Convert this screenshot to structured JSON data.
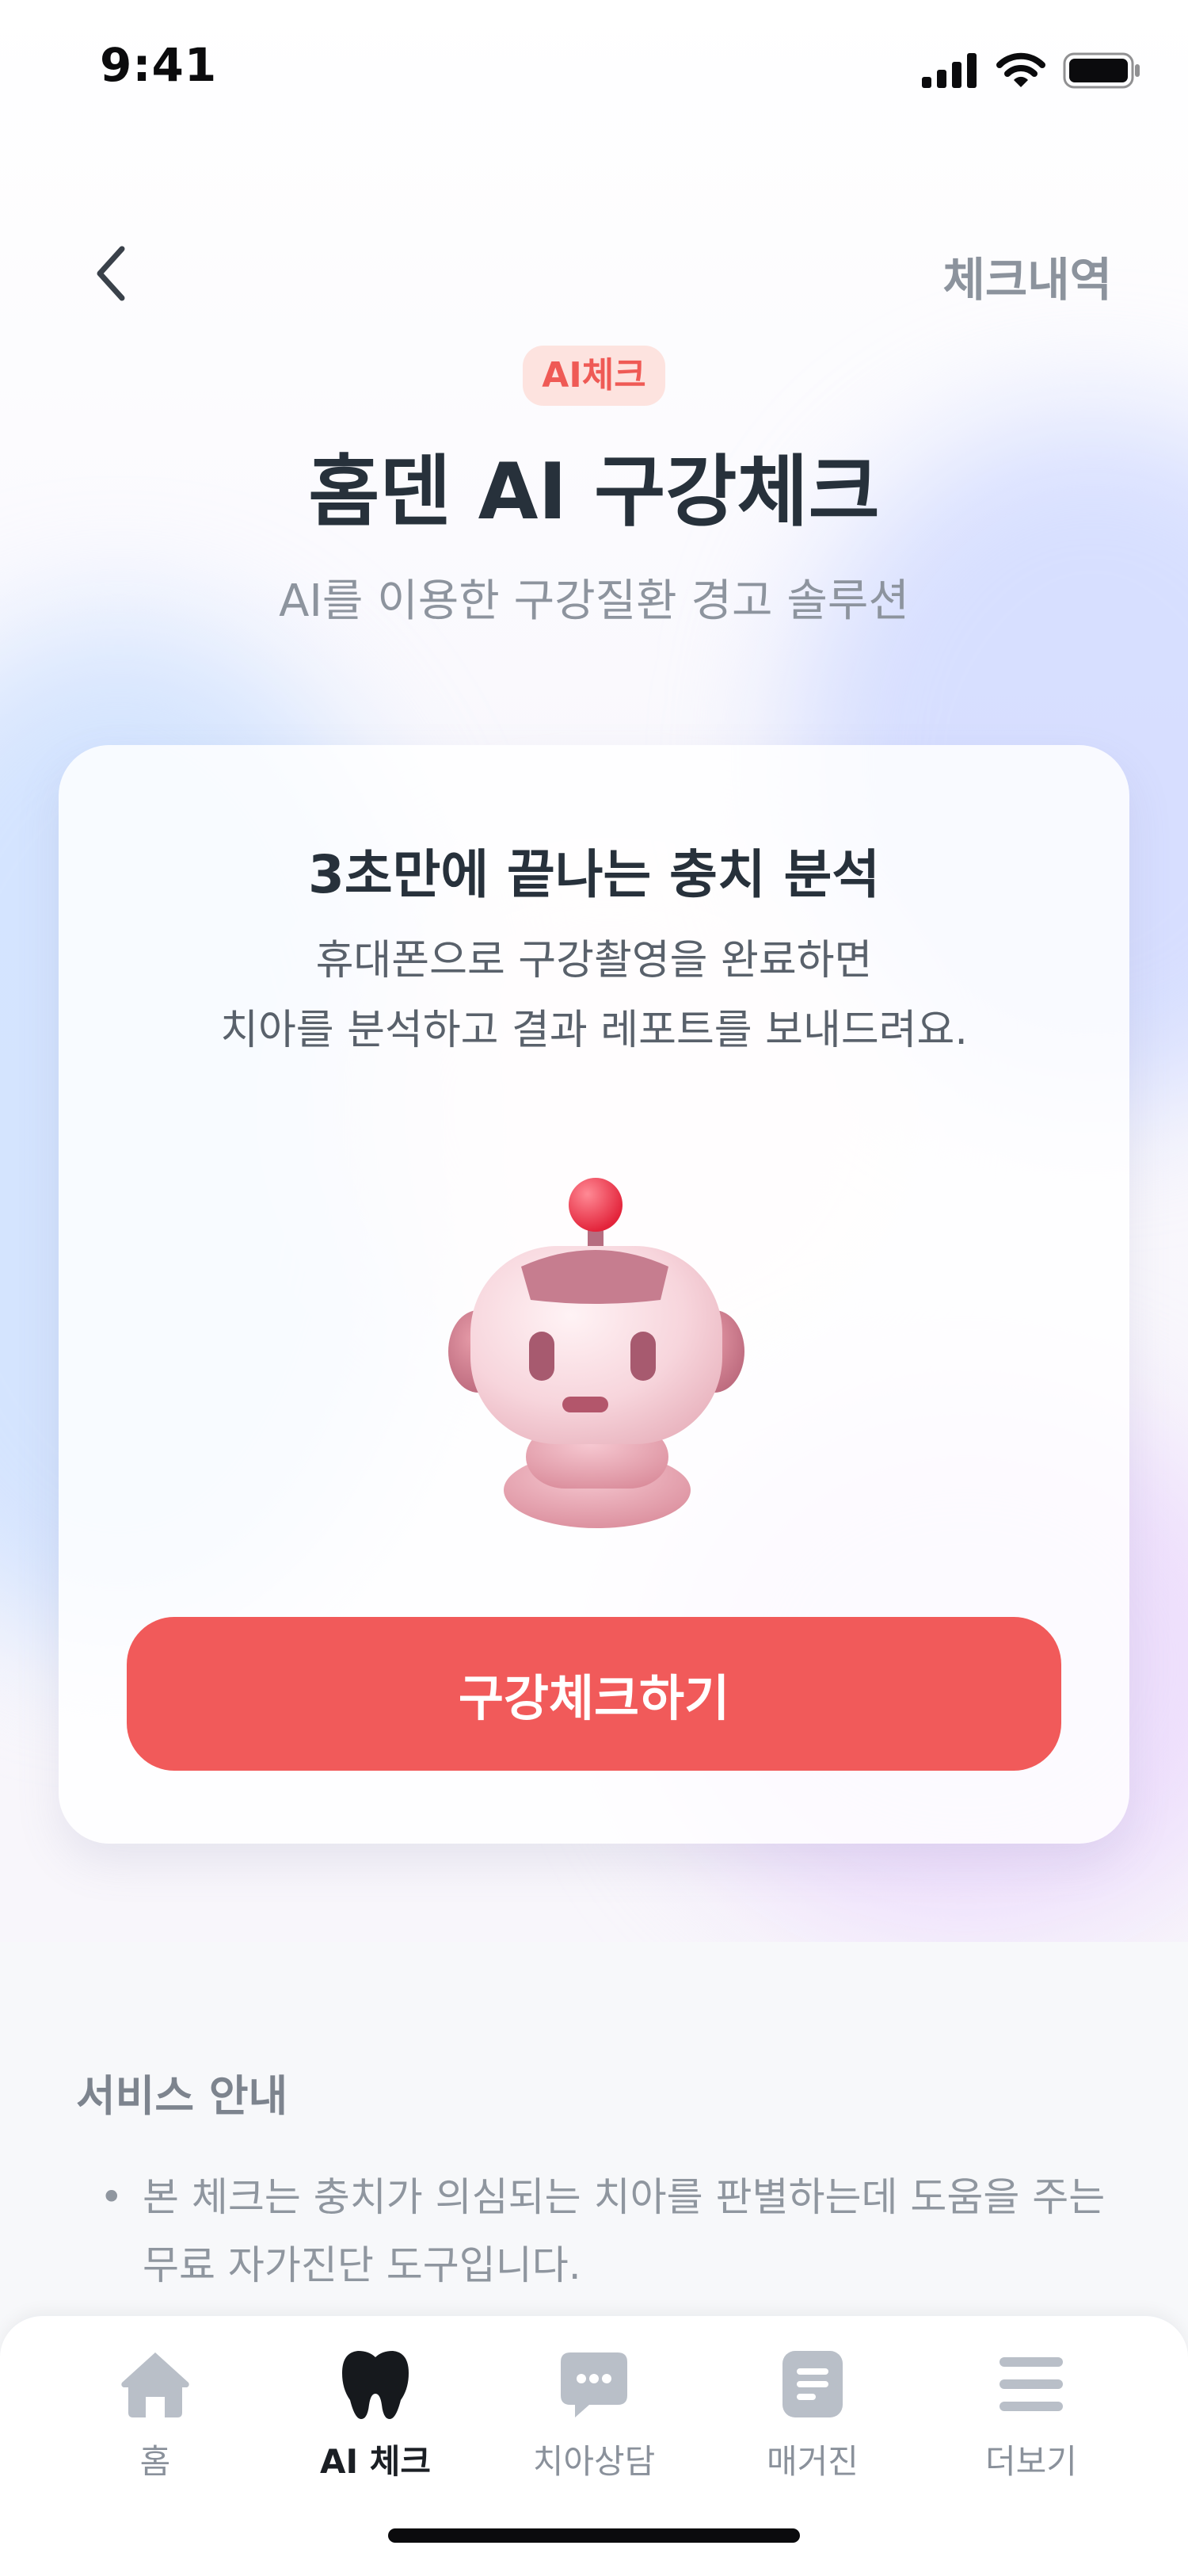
{
  "status_bar": {
    "time": "9:41"
  },
  "header": {
    "history_label": "체크내역"
  },
  "hero": {
    "badge": "AI체크",
    "title": "홈덴 AI 구강체크",
    "subtitle": "AI를 이용한 구강질환 경고 솔루션"
  },
  "card": {
    "title": "3초만에 끝나는 충치 분석",
    "desc_line1": "휴대폰으로 구강촬영을 완료하면",
    "desc_line2": "치아를 분석하고 결과 레포트를 보내드려요.",
    "cta_label": "구강체크하기"
  },
  "service": {
    "title": "서비스 안내",
    "items": [
      "본 체크는 충치가 의심되는 치아를 판별하는데 도움을 주는 무료 자가진단 도구입니다."
    ]
  },
  "tabbar": {
    "tabs": [
      {
        "label": "홈",
        "icon": "home-icon"
      },
      {
        "label": "AI 체크",
        "icon": "tooth-icon"
      },
      {
        "label": "치아상담",
        "icon": "chat-bubble-icon"
      },
      {
        "label": "매거진",
        "icon": "document-icon"
      },
      {
        "label": "더보기",
        "icon": "menu-icon"
      }
    ],
    "active_index": 1
  },
  "colors": {
    "accent": "#F15A5A",
    "badge_bg": "#FDE3DF",
    "title_text": "#27313B",
    "muted_text": "#8D949E"
  }
}
